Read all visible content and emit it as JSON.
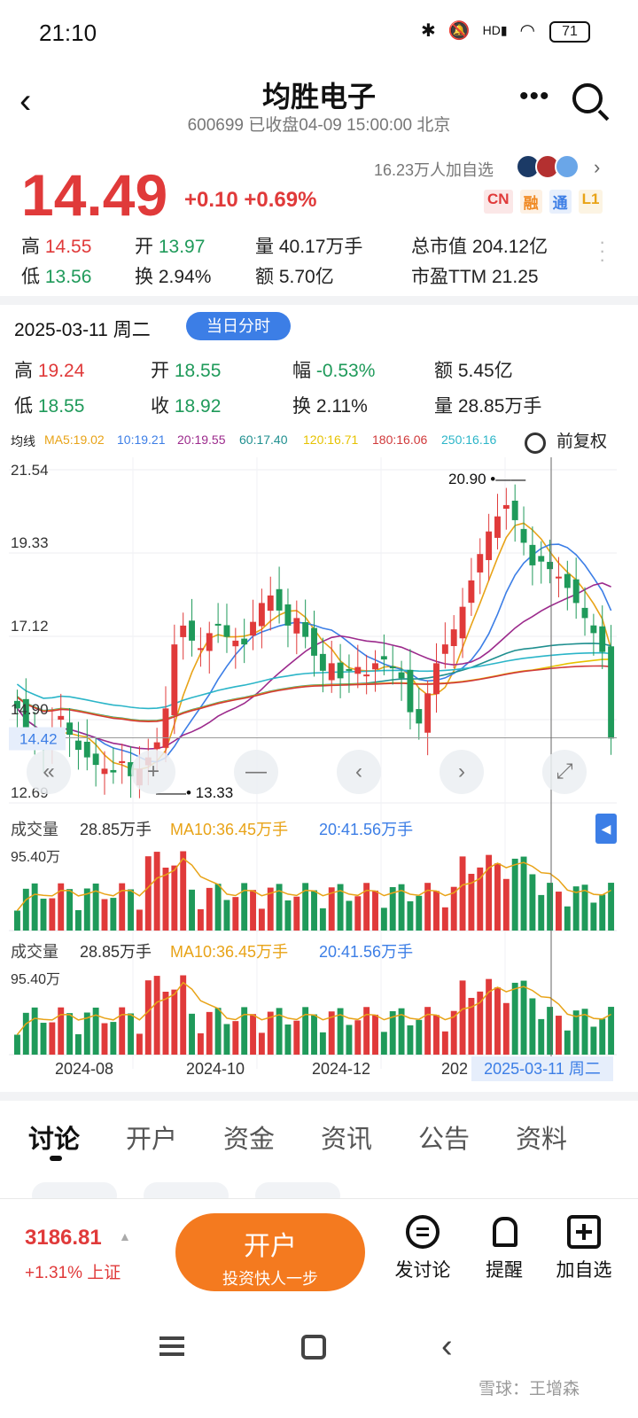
{
  "status_bar": {
    "time": "21:10",
    "battery": "71"
  },
  "header": {
    "name": "均胜电子",
    "subtitle": "600699 已收盘04-09 15:00:00 北京"
  },
  "quote": {
    "price": "14.49",
    "change": "+0.10 +0.69%",
    "followers": "16.23万人加自选",
    "badges": [
      "CN",
      "融",
      "通",
      "L1"
    ],
    "badge_colors": [
      "#e03a3a",
      "#f08a24",
      "#3c7ee6",
      "#e8a317"
    ],
    "stats": [
      {
        "label": "高",
        "value": "14.55",
        "color": "red"
      },
      {
        "label": "开",
        "value": "13.97",
        "color": "green"
      },
      {
        "label": "量",
        "value": "40.17万手",
        "color": "black"
      },
      {
        "label": "总市值",
        "value": "204.12亿",
        "color": "black"
      },
      {
        "label": "低",
        "value": "13.56",
        "color": "green"
      },
      {
        "label": "换",
        "value": "2.94%",
        "color": "black"
      },
      {
        "label": "额",
        "value": "5.70亿",
        "color": "black"
      },
      {
        "label": "市盈TTM",
        "value": "21.25",
        "color": "black"
      }
    ]
  },
  "selected_day": {
    "date": "2025-03-11 周二",
    "button": "当日分时",
    "stats": [
      {
        "label": "高",
        "value": "19.24",
        "color": "red"
      },
      {
        "label": "开",
        "value": "18.55",
        "color": "green"
      },
      {
        "label": "幅",
        "value": "-0.53%",
        "color": "green"
      },
      {
        "label": "额",
        "value": "5.45亿",
        "color": "black"
      },
      {
        "label": "低",
        "value": "18.55",
        "color": "green"
      },
      {
        "label": "收",
        "value": "18.92",
        "color": "green"
      },
      {
        "label": "换",
        "value": "2.11%",
        "color": "black"
      },
      {
        "label": "量",
        "value": "28.85万手",
        "color": "black"
      }
    ]
  },
  "ma_row": {
    "title": "均线",
    "items": [
      {
        "text": "MA5:19.02",
        "color": "#e8a317"
      },
      {
        "text": "10:19.21",
        "color": "#3c7ee6"
      },
      {
        "text": "20:19.55",
        "color": "#9c2a8c"
      },
      {
        "text": "60:17.40",
        "color": "#1f8f8f"
      },
      {
        "text": "120:16.71",
        "color": "#e6c200"
      },
      {
        "text": "180:16.06",
        "color": "#d0393a"
      },
      {
        "text": "250:16.16",
        "color": "#2bb5c8"
      }
    ],
    "adjust": "前复权"
  },
  "chart_data": {
    "type": "candlestick",
    "y_axis_labels": [
      "21.54",
      "19.33",
      "17.12",
      "14.90",
      "12.69"
    ],
    "current_price_label": "14.42",
    "max_label": "20.90",
    "min_label": "13.33",
    "x_labels": [
      "2024-08",
      "2024-10",
      "2024-12",
      "202"
    ],
    "crosshair_date": "2025-03-11 周二",
    "approx_closes": [
      15.2,
      14.6,
      14.4,
      14.1,
      14.7,
      15.0,
      14.5,
      14.1,
      13.9,
      13.7,
      13.6,
      13.5,
      13.8,
      13.4,
      13.6,
      13.9,
      14.3,
      15.2,
      16.9,
      17.4,
      17.0,
      16.8,
      17.2,
      17.4,
      17.1,
      17.0,
      16.9,
      17.5,
      18.0,
      18.2,
      17.8,
      17.4,
      17.6,
      17.1,
      16.6,
      16.2,
      16.4,
      16.0,
      16.2,
      16.3,
      16.1,
      16.4,
      16.5,
      16.3,
      16.0,
      15.1,
      14.8,
      15.6,
      16.4,
      16.9,
      17.3,
      17.9,
      18.6,
      19.3,
      19.9,
      20.3,
      20.6,
      20.2,
      19.6,
      19.0,
      19.1,
      18.9,
      18.7,
      18.4,
      18.0,
      17.6,
      17.2,
      16.7,
      14.4
    ],
    "volume_label": "成交量",
    "volume_stats": [
      "28.85万手",
      "MA10:36.45万手",
      "20:41.56万手"
    ],
    "volume_max_label": "95.40万"
  },
  "tabs": [
    "讨论",
    "开户",
    "资金",
    "资讯",
    "公告",
    "资料"
  ],
  "bottom_bar": {
    "index_value": "3186.81",
    "index_change": "+1.31% 上证",
    "open_title": "开户",
    "open_sub": "投资快人一步",
    "actions": [
      "发讨论",
      "提醒",
      "加自选"
    ]
  },
  "watermark": "雪球：王增森"
}
